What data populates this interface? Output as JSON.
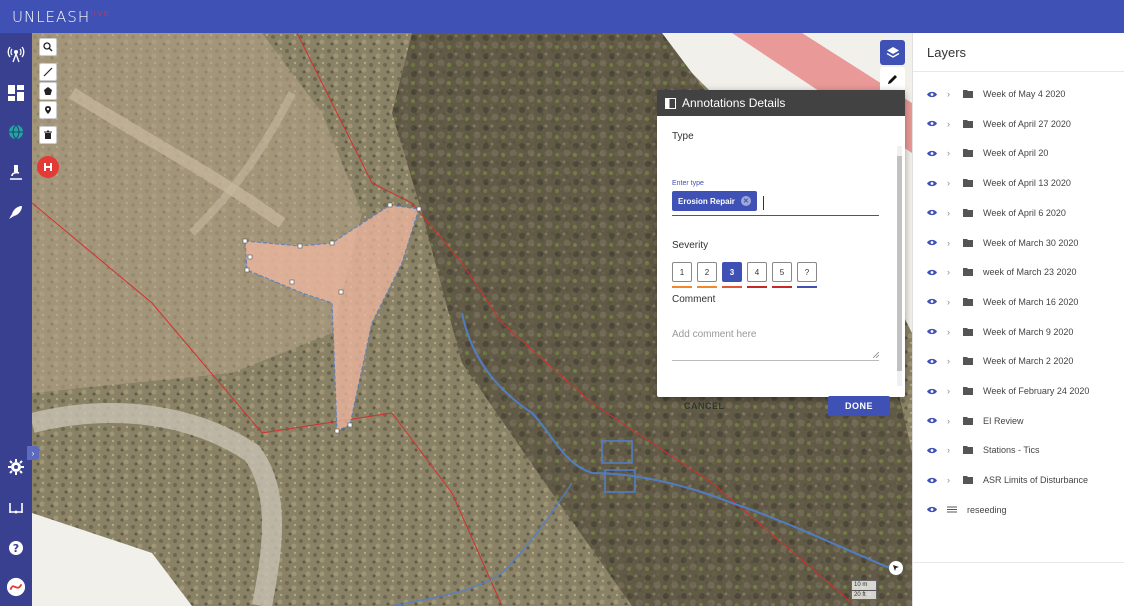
{
  "app": {
    "logo": "UNLEASH",
    "logo_suffix": "live"
  },
  "panel": {
    "title": "Annotations Details",
    "type_label": "Type",
    "enter_type": "Enter type",
    "chip": "Erosion Repair",
    "severity_label": "Severity",
    "severity": [
      "1",
      "2",
      "3",
      "4",
      "5",
      "?"
    ],
    "severity_colors": [
      "#f0882c",
      "#f0882c",
      "#e5553a",
      "#c62828",
      "#c62828",
      "#3f51b5"
    ],
    "selected_severity": "3",
    "comment_label": "Comment",
    "comment_placeholder": "Add comment here",
    "cancel": "CANCEL",
    "done": "DONE"
  },
  "layers": {
    "title": "Layers",
    "items": [
      {
        "label": "Week of May 4 2020",
        "kind": "folder"
      },
      {
        "label": "Week of April 27 2020",
        "kind": "folder"
      },
      {
        "label": "Week of April 20",
        "kind": "folder"
      },
      {
        "label": "Week of April 13 2020",
        "kind": "folder"
      },
      {
        "label": "Week of April 6 2020",
        "kind": "folder"
      },
      {
        "label": "Week of March 30 2020",
        "kind": "folder"
      },
      {
        "label": "week of March 23 2020",
        "kind": "folder"
      },
      {
        "label": "Week of March 16 2020",
        "kind": "folder"
      },
      {
        "label": "Week of March 9 2020",
        "kind": "folder"
      },
      {
        "label": "Week of March 2 2020",
        "kind": "folder"
      },
      {
        "label": "Week of February 24 2020",
        "kind": "folder"
      },
      {
        "label": "EI Review",
        "kind": "folder"
      },
      {
        "label": "Stations - Tics",
        "kind": "folder"
      },
      {
        "label": "ASR Limits of Disturbance",
        "kind": "folder"
      },
      {
        "label": "reseeding",
        "kind": "list"
      }
    ]
  },
  "scale": {
    "metric": "10 m",
    "imperial": "20 ft"
  },
  "colors": {
    "brand": "#3f51b5",
    "danger": "#e53935",
    "sidebar": "#39408f"
  }
}
